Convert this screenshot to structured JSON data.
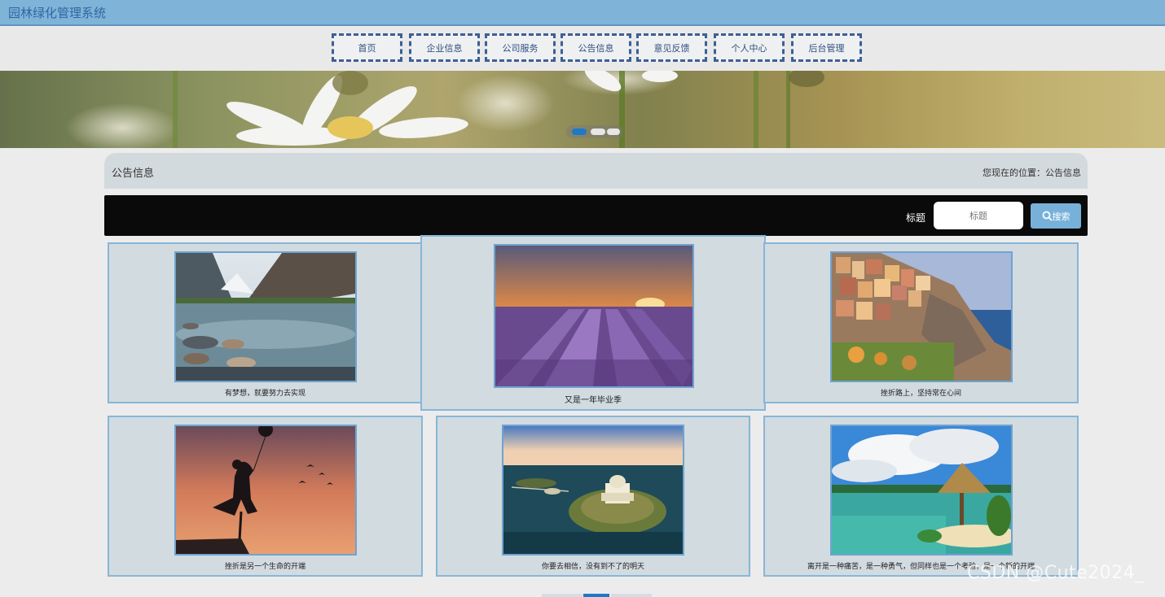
{
  "header": {
    "site_title": "园林绿化管理系统"
  },
  "nav": {
    "items": [
      {
        "label": "首页"
      },
      {
        "label": "企业信息"
      },
      {
        "label": "公司服务"
      },
      {
        "label": "公告信息"
      },
      {
        "label": "意见反馈"
      },
      {
        "label": "个人中心"
      },
      {
        "label": "后台管理"
      }
    ]
  },
  "banner": {
    "slide_count": 3,
    "active_slide": 1
  },
  "panel": {
    "title": "公告信息",
    "breadcrumb": "您现在的位置：公告信息"
  },
  "search": {
    "label": "标题",
    "placeholder": "标题",
    "button_label": "搜索",
    "icon": "search-icon"
  },
  "cards": [
    {
      "caption": "有梦想，就要努力去实现"
    },
    {
      "caption": "又是一年毕业季"
    },
    {
      "caption": "挫折路上，坚持常在心间"
    },
    {
      "caption": "挫折是另一个生命的开端"
    },
    {
      "caption": "你要去相信，没有到不了的明天"
    },
    {
      "caption": "离开是一种痛苦，是一种勇气，但同样也是一个考验，是一个新的开端"
    }
  ],
  "watermark": "CSDN @Cute2024_",
  "colors": {
    "topbar": "#7fb3d8",
    "nav_border": "#3d5f94",
    "card_bg": "#d2dbe0",
    "card_border": "#86b6d8",
    "search_button": "#77b1d9",
    "active_dot": "#1e78c8"
  }
}
